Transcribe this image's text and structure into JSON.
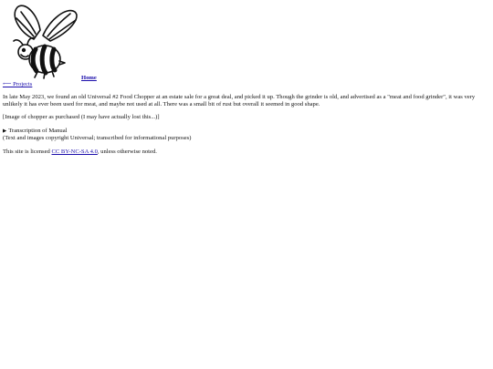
{
  "header": {
    "home_label": "Home",
    "logo_icon": "bee-logo-icon"
  },
  "nav": {
    "back_label": "⟵ Projects"
  },
  "article": {
    "intro": "In late May 2023, we found an old Universal #2 Food Chopper at an estate sale for a great deal, and picked it up. Though the grinder is old, and advertised as a \"meat and food grinder\", it was very unlikely it has ever been used for meat, and maybe not used at all. There was a small bit of rust but overall it seemed in good shape.",
    "image_placeholder": "[Image of chopper as purchased (I may have actually lost this...)]",
    "transcription": {
      "marker": "▶",
      "summary": "Transcription of Manual",
      "note": "(Text and images copyright Universal; transcribed for informational purposes)"
    }
  },
  "footer": {
    "prefix": "This site is licensed ",
    "license_label": "CC BY-NC-SA 4.0",
    "suffix": ", unless otherwise noted."
  }
}
